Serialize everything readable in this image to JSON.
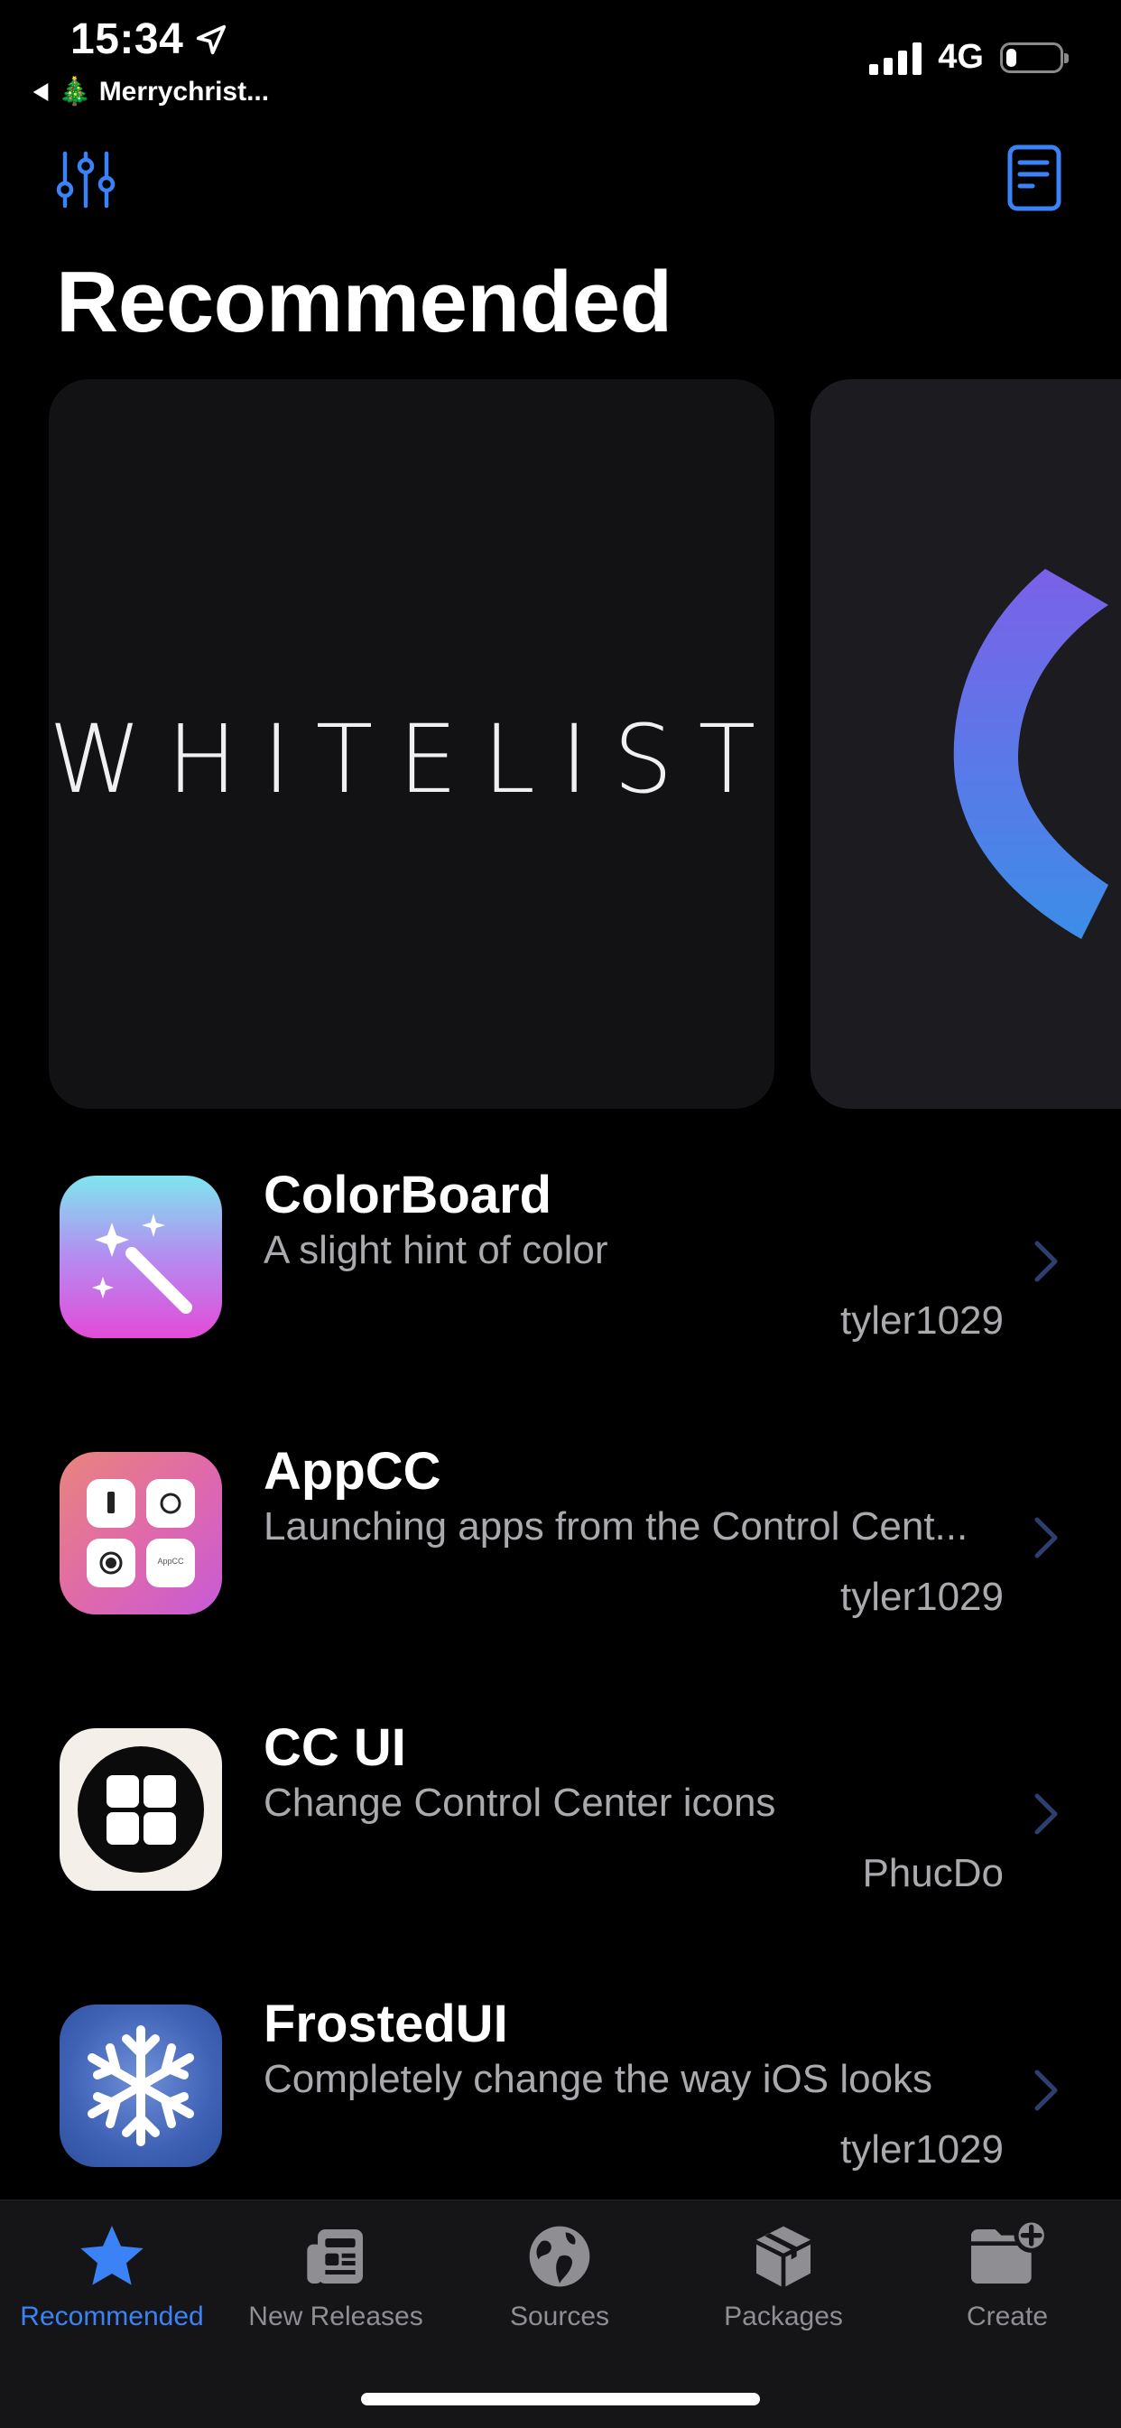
{
  "status_bar": {
    "time": "15:34",
    "back_app": "🎄 Merrychrist...",
    "network": "4G",
    "battery_percent": 20
  },
  "nav": {
    "left_icon": "filter-sliders-icon",
    "right_icon": "document-icon",
    "title": "Recommended"
  },
  "featured": [
    {
      "brand": "WHITELIST"
    },
    {
      "brand": ""
    }
  ],
  "packages": [
    {
      "name": "ColorBoard",
      "description": "A slight hint of color",
      "author": "tyler1029",
      "icon": "magic-wand-icon"
    },
    {
      "name": "AppCC",
      "description": "Launching apps from the Control Cent...",
      "author": "tyler1029",
      "icon": "appcc-grid-icon",
      "icon_small_text": "AppCC"
    },
    {
      "name": "CC UI",
      "description": "Change Control Center icons",
      "author": "PhucDo",
      "icon": "grid-circle-icon"
    },
    {
      "name": "FrostedUI",
      "description": "Completely change the way iOS looks",
      "author": "tyler1029",
      "icon": "snowflake-icon"
    }
  ],
  "tabs": [
    {
      "label": "Recommended",
      "icon": "star-icon",
      "active": true
    },
    {
      "label": "New Releases",
      "icon": "newspaper-icon",
      "active": false
    },
    {
      "label": "Sources",
      "icon": "globe-icon",
      "active": false
    },
    {
      "label": "Packages",
      "icon": "box-icon",
      "active": false
    },
    {
      "label": "Create",
      "icon": "folder-plus-icon",
      "active": false
    }
  ],
  "colors": {
    "accent": "#3b82f6",
    "background": "#000000",
    "secondary_text": "#a9a9ae"
  }
}
